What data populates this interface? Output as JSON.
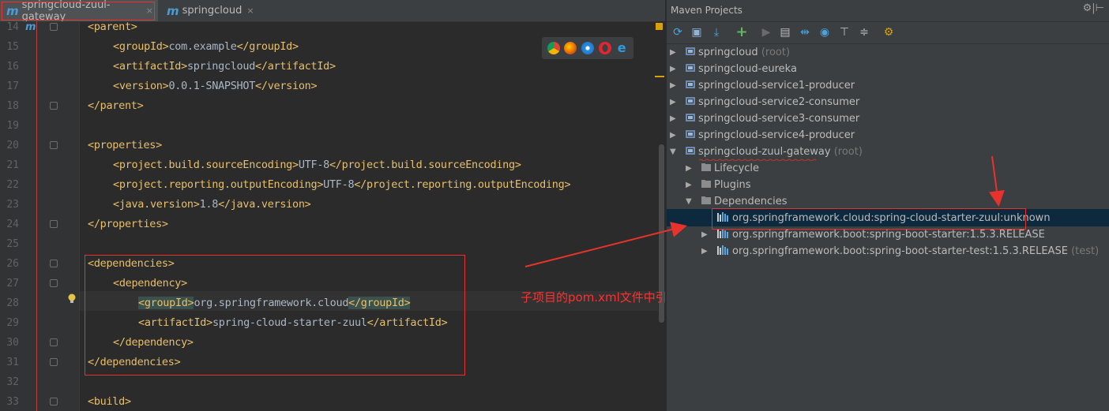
{
  "editor": {
    "tabs": [
      {
        "label": "springcloud-zuul-gateway",
        "active": true
      },
      {
        "label": "springcloud",
        "active": false
      }
    ],
    "tab_close": "×",
    "module_badge": "m",
    "lines": [
      {
        "num": "14",
        "indent": 0,
        "text": "<parent>"
      },
      {
        "num": "15",
        "indent": 1,
        "text": "<groupId>com.example</groupId>"
      },
      {
        "num": "16",
        "indent": 1,
        "text": "<artifactId>springcloud</artifactId>"
      },
      {
        "num": "17",
        "indent": 1,
        "text": "<version>0.0.1-SNAPSHOT</version>"
      },
      {
        "num": "18",
        "indent": 0,
        "text": "</parent>"
      },
      {
        "num": "19",
        "indent": 0,
        "text": ""
      },
      {
        "num": "20",
        "indent": 0,
        "text": "<properties>"
      },
      {
        "num": "21",
        "indent": 1,
        "text": "<project.build.sourceEncoding>UTF-8</project.build.sourceEncoding>"
      },
      {
        "num": "22",
        "indent": 1,
        "text": "<project.reporting.outputEncoding>UTF-8</project.reporting.outputEncoding>"
      },
      {
        "num": "23",
        "indent": 1,
        "text": "<java.version>1.8</java.version>"
      },
      {
        "num": "24",
        "indent": 0,
        "text": "</properties>"
      },
      {
        "num": "25",
        "indent": 0,
        "text": ""
      },
      {
        "num": "26",
        "indent": 0,
        "text": "<dependencies>"
      },
      {
        "num": "27",
        "indent": 1,
        "text": "<dependency>"
      },
      {
        "num": "28",
        "indent": 2,
        "text": "<groupId>org.springframework.cloud</groupId>",
        "matched": true
      },
      {
        "num": "29",
        "indent": 2,
        "text": "<artifactId>spring-cloud-starter-zuul</artifactId>"
      },
      {
        "num": "30",
        "indent": 1,
        "text": "</dependency>"
      },
      {
        "num": "31",
        "indent": 0,
        "text": "</dependencies>"
      },
      {
        "num": "32",
        "indent": 0,
        "text": ""
      },
      {
        "num": "33",
        "indent": 0,
        "text": "<build>"
      }
    ],
    "annotation": "子项目的pom.xml文件中引用的jar包都是unknown的"
  },
  "maven": {
    "title": "Maven Projects",
    "settings_icon": "⚙",
    "toolbar_icons": [
      "reimport-icon",
      "generate-sources-icon",
      "download-icon",
      "add-icon",
      "run-icon",
      "execute-goal-icon",
      "toggle-offline-icon",
      "skip-tests-icon",
      "show-dependencies-icon",
      "collapse-all-icon",
      "settings-icon"
    ],
    "projects": [
      {
        "label": "springcloud",
        "suffix": "(root)",
        "expanded": false
      },
      {
        "label": "springcloud-eureka",
        "suffix": "",
        "expanded": false
      },
      {
        "label": "springcloud-service1-producer",
        "suffix": "",
        "expanded": false
      },
      {
        "label": "springcloud-service2-consumer",
        "suffix": "",
        "expanded": false
      },
      {
        "label": "springcloud-service3-consumer",
        "suffix": "",
        "expanded": false
      },
      {
        "label": "springcloud-service4-producer",
        "suffix": "",
        "expanded": false
      },
      {
        "label": "springcloud-zuul-gateway",
        "suffix": "(root)",
        "expanded": true
      }
    ],
    "children": [
      {
        "label": "Lifecycle",
        "expanded": false
      },
      {
        "label": "Plugins",
        "expanded": false
      },
      {
        "label": "Dependencies",
        "expanded": true
      }
    ],
    "dependencies": [
      {
        "label": "org.springframework.cloud:spring-cloud-starter-zuul:unknown",
        "suffix": "",
        "selected": true,
        "has_children": false
      },
      {
        "label": "org.springframework.boot:spring-boot-starter:1.5.3.RELEASE",
        "suffix": "",
        "selected": false,
        "has_children": true
      },
      {
        "label": "org.springframework.boot:spring-boot-starter-test:1.5.3.RELEASE",
        "suffix": "(test)",
        "selected": false,
        "has_children": true
      }
    ]
  },
  "colors": {
    "annotation": "#ff3030",
    "tag": "#e8bf6a",
    "text": "#a9b7c6",
    "selection": "#0d293e"
  }
}
